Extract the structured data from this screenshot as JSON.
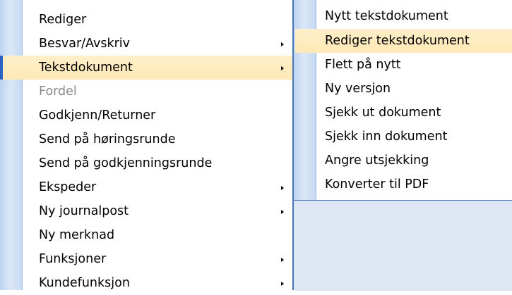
{
  "main_menu": {
    "items": [
      {
        "label": "Rediger",
        "submenu": false
      },
      {
        "label": "Besvar/Avskriv",
        "submenu": true
      },
      {
        "label": "Tekstdokument",
        "submenu": true,
        "state": "active"
      },
      {
        "label": "Fordel",
        "submenu": false,
        "state": "disabled"
      },
      {
        "label": "Godkjenn/Returner",
        "submenu": false
      },
      {
        "label": "Send på høringsrunde",
        "submenu": false
      },
      {
        "label": "Send på godkjenningsrunde",
        "submenu": false
      },
      {
        "label": "Ekspeder",
        "submenu": true
      },
      {
        "label": "Ny journalpost",
        "submenu": true
      },
      {
        "label": "Ny merknad",
        "submenu": false
      },
      {
        "label": "Funksjoner",
        "submenu": true
      },
      {
        "label": "Kundefunksjon",
        "submenu": true
      }
    ]
  },
  "sub_menu": {
    "items": [
      {
        "label": "Nytt tekstdokument"
      },
      {
        "label": "Rediger tekstdokument",
        "state": "hovered"
      },
      {
        "label": "Flett på nytt"
      },
      {
        "label": "Ny versjon"
      },
      {
        "label": "Sjekk ut dokument"
      },
      {
        "label": "Sjekk inn dokument"
      },
      {
        "label": "Angre utsjekking"
      },
      {
        "label": "Konverter til PDF"
      }
    ]
  },
  "icons": {
    "submenu_arrow": "chevron-right-icon"
  },
  "colors": {
    "highlight": "#ffe9ba",
    "disabled_text": "#8a8a8a",
    "divider": "#4b76b4",
    "icon_strip": "#c9dbf2",
    "panel_background": "#dde7f4"
  }
}
